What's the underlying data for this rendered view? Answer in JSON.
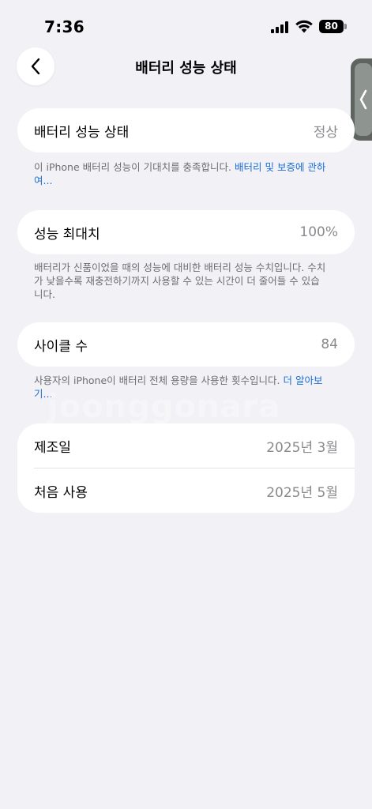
{
  "status_bar": {
    "time": "7:36",
    "battery_level": "80"
  },
  "nav": {
    "title": "배터리 성능 상태"
  },
  "health": {
    "label": "배터리 성능 상태",
    "value": "정상",
    "footnote_text": "이 iPhone 배터리 성능이 기대치를 충족합니다. ",
    "footnote_link": "배터리 및 보증에 관하여..."
  },
  "max_capacity": {
    "label": "성능 최대치",
    "value": "100%",
    "footnote_text": "배터리가 신품이었을 때의 성능에 대비한 배터리 성능 수치입니다. 수치가 낮을수록 재충전하기까지 사용할 수 있는 시간이 더 줄어들 수 있습니다."
  },
  "cycle_count": {
    "label": "사이클 수",
    "value": "84",
    "footnote_text": "사용자의 iPhone이 배터리 전체 용량을 사용한 횟수입니다. ",
    "footnote_link": "더 알아보기..."
  },
  "dates": {
    "manufacture_label": "제조일",
    "manufacture_value": "2025년 3월",
    "first_use_label": "처음 사용",
    "first_use_value": "2025년 5월"
  },
  "watermark": "joonggonara"
}
